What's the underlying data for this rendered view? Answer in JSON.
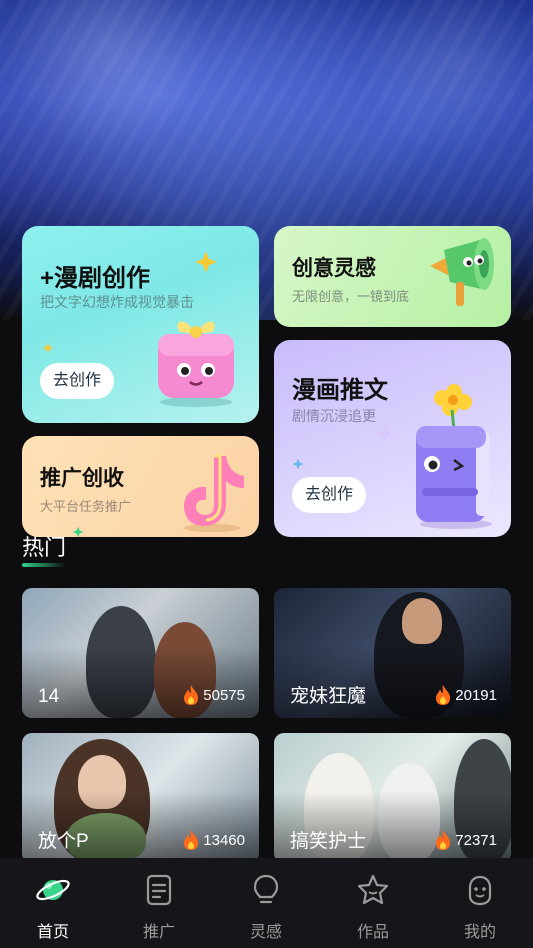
{
  "cards": {
    "create": {
      "title": "+漫剧创作",
      "subtitle": "把文字幻想炸成视觉暴击",
      "button": "去创作"
    },
    "idea": {
      "title": "创意灵感",
      "subtitle": "无限创意，一镜到底"
    },
    "comic": {
      "title": "漫画推文",
      "subtitle": "剧情沉浸追更",
      "button": "去创作"
    },
    "promo": {
      "title": "推广创收",
      "subtitle": "大平台任务推广"
    }
  },
  "section": {
    "title": "热门"
  },
  "hot": [
    {
      "name": "14",
      "heat": "50575"
    },
    {
      "name": "宠妹狂魔",
      "heat": "20191"
    },
    {
      "name": "放个P",
      "heat": "13460"
    },
    {
      "name": "搞笑护士",
      "heat": "72371"
    }
  ],
  "tabs": [
    {
      "label": "首页",
      "icon": "planet-icon",
      "active": true
    },
    {
      "label": "推广",
      "icon": "document-icon"
    },
    {
      "label": "灵感",
      "icon": "lightbulb-icon"
    },
    {
      "label": "作品",
      "icon": "star-icon"
    },
    {
      "label": "我的",
      "icon": "profile-icon"
    }
  ],
  "colors": {
    "accent": "#37d48a",
    "tab_inactive": "#9a9a9a",
    "background": "#0d0d10"
  }
}
